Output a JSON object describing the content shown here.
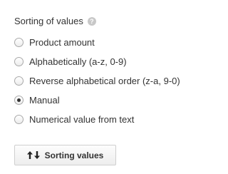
{
  "sorting": {
    "title": "Sorting of values",
    "help_icon": "question-circle-icon",
    "selected": "manual",
    "options": [
      {
        "id": "product-amount",
        "label": "Product amount",
        "checked": false
      },
      {
        "id": "alphabetically",
        "label": "Alphabetically (a-z, 0-9)",
        "checked": false
      },
      {
        "id": "reverse-alphabetical",
        "label": "Reverse alphabetical order (z-a, 9-0)",
        "checked": false
      },
      {
        "id": "manual",
        "label": "Manual",
        "checked": true
      },
      {
        "id": "numerical-value",
        "label": "Numerical value from text",
        "checked": false
      }
    ],
    "button": {
      "label": "Sorting values",
      "icon": "sort-up-down-arrows-icon"
    }
  }
}
